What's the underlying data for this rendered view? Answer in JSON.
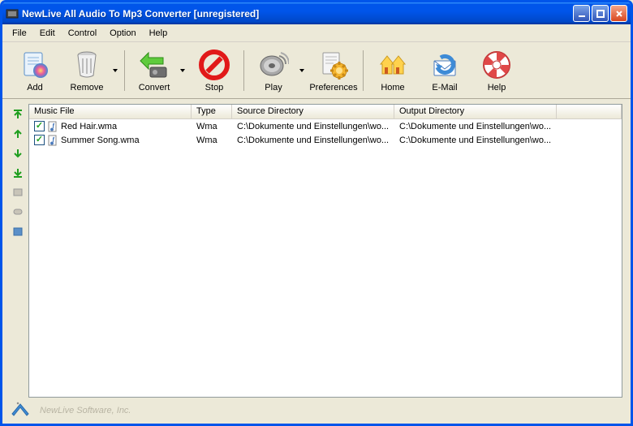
{
  "window": {
    "title": "NewLive All Audio To Mp3 Converter  [unregistered]"
  },
  "menu": {
    "file": "File",
    "edit": "Edit",
    "control": "Control",
    "option": "Option",
    "help": "Help"
  },
  "toolbar": {
    "add": "Add",
    "remove": "Remove",
    "convert": "Convert",
    "stop": "Stop",
    "play": "Play",
    "preferences": "Preferences",
    "home": "Home",
    "email": "E-Mail",
    "help": "Help"
  },
  "columns": {
    "file": "Music File",
    "type": "Type",
    "source": "Source Directory",
    "output": "Output Directory"
  },
  "rows": [
    {
      "checked": true,
      "file": "Red Hair.wma",
      "type": "Wma",
      "source": "C:\\Dokumente und Einstellungen\\wo...",
      "output": "C:\\Dokumente und Einstellungen\\wo..."
    },
    {
      "checked": true,
      "file": "Summer Song.wma",
      "type": "Wma",
      "source": "C:\\Dokumente und Einstellungen\\wo...",
      "output": "C:\\Dokumente und Einstellungen\\wo..."
    }
  ],
  "footer": {
    "company": "NewLive Software, Inc."
  }
}
